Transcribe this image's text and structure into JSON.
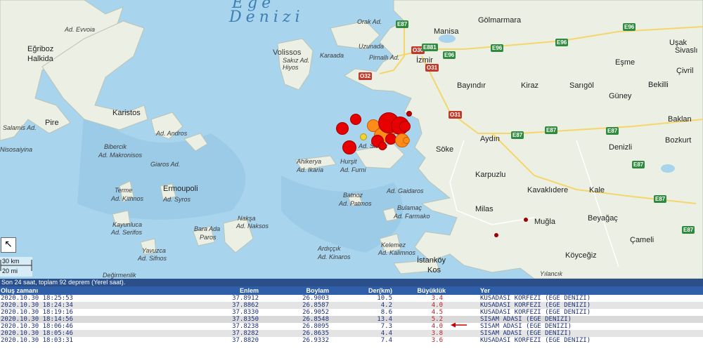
{
  "map": {
    "sea_name_line1": "Ege",
    "sea_name_line2": "Denizi",
    "scale": {
      "km": "30 km",
      "mi": "20 mi"
    },
    "cities": [
      {
        "id": "manisa",
        "name": "Manisa"
      },
      {
        "id": "golmarmara",
        "name": "Gölmarmara"
      },
      {
        "id": "usak",
        "name": "Uşak"
      },
      {
        "id": "izmir",
        "name": "İzmir"
      },
      {
        "id": "bayindir",
        "name": "Bayındır"
      },
      {
        "id": "kiraz",
        "name": "Kiraz"
      },
      {
        "id": "sarigol",
        "name": "Sarıgöl"
      },
      {
        "id": "esme",
        "name": "Eşme"
      },
      {
        "id": "sivasli",
        "name": "Sivaslı"
      },
      {
        "id": "civril",
        "name": "Çivril"
      },
      {
        "id": "guney",
        "name": "Güney"
      },
      {
        "id": "bekilli",
        "name": "Bekilli"
      },
      {
        "id": "baklan",
        "name": "Baklan"
      },
      {
        "id": "denizli",
        "name": "Denizli"
      },
      {
        "id": "bozkurt",
        "name": "Bozkurt"
      },
      {
        "id": "aydin",
        "name": "Aydın"
      },
      {
        "id": "soke",
        "name": "Söke"
      },
      {
        "id": "karpuzlu",
        "name": "Karpuzlu"
      },
      {
        "id": "kavaklidere",
        "name": "Kavaklıdere"
      },
      {
        "id": "kale",
        "name": "Kale"
      },
      {
        "id": "milas",
        "name": "Milas"
      },
      {
        "id": "mugla",
        "name": "Muğla"
      },
      {
        "id": "beyagac",
        "name": "Beyağaç"
      },
      {
        "id": "cameli",
        "name": "Çameli"
      },
      {
        "id": "koycegiz",
        "name": "Köyceğiz"
      },
      {
        "id": "istankoy",
        "name": "İstanköy"
      },
      {
        "id": "kos",
        "name": "Kos"
      },
      {
        "id": "egriboz",
        "name": "Eğriboz"
      },
      {
        "id": "halkida",
        "name": "Halkida"
      },
      {
        "id": "pire",
        "name": "Pire"
      },
      {
        "id": "karistos",
        "name": "Karistos"
      },
      {
        "id": "ermoupoli",
        "name": "Ermoupoli"
      }
    ],
    "islands": [
      {
        "id": "evvoia",
        "name": "Ad. Evvoia"
      },
      {
        "id": "volissos",
        "name": "Volissos"
      },
      {
        "id": "sakiz",
        "name": "Sakız Ad."
      },
      {
        "id": "hiyos",
        "name": "Hiyos"
      },
      {
        "id": "karaada",
        "name": "Karaada"
      },
      {
        "id": "orak",
        "name": "Orak Ad."
      },
      {
        "id": "uzunada",
        "name": "Uzunada"
      },
      {
        "id": "pirnalli",
        "name": "Pirnallı Ad."
      },
      {
        "id": "salamis",
        "name": "Salamis Ad."
      },
      {
        "id": "nisosaiyina",
        "name": "Nisosaiyina"
      },
      {
        "id": "andros",
        "name": "Ad. Andros"
      },
      {
        "id": "bibercik",
        "name": "Bibercik"
      },
      {
        "id": "makronisos",
        "name": "Ad. Makronisos"
      },
      {
        "id": "giaros",
        "name": "Giaros Ad."
      },
      {
        "id": "ahikerya",
        "name": "Ahikerya"
      },
      {
        "id": "ikaria",
        "name": "Ad. Ikaria"
      },
      {
        "id": "sisam",
        "name": "Ad. Sisam"
      },
      {
        "id": "hursit",
        "name": "Hurşit"
      },
      {
        "id": "furni",
        "name": "Ad. Furni"
      },
      {
        "id": "terme",
        "name": "Terme"
      },
      {
        "id": "kithnos",
        "name": "Ad. Kithnos"
      },
      {
        "id": "syros",
        "name": "Ad. Syros"
      },
      {
        "id": "batnoz",
        "name": "Batnoz"
      },
      {
        "id": "patmos",
        "name": "Ad. Patmos"
      },
      {
        "id": "gaidaros",
        "name": "Ad. Gaidaros"
      },
      {
        "id": "bulamac",
        "name": "Bulamaç"
      },
      {
        "id": "farmako",
        "name": "Ad. Farmako"
      },
      {
        "id": "kayunluca",
        "name": "Kayunluca"
      },
      {
        "id": "serifos",
        "name": "Ad. Serifos"
      },
      {
        "id": "naksa",
        "name": "Nakşa"
      },
      {
        "id": "naksos",
        "name": "Ad. Naksos"
      },
      {
        "id": "baraada",
        "name": "Bara Ada"
      },
      {
        "id": "paros",
        "name": "Paros"
      },
      {
        "id": "yavuzca",
        "name": "Yavuzca"
      },
      {
        "id": "sifnos",
        "name": "Ad. Sifnos"
      },
      {
        "id": "ardiccik",
        "name": "Ardıççık"
      },
      {
        "id": "kinaros",
        "name": "Ad. Kinaros"
      },
      {
        "id": "kelemez",
        "name": "Kelemez"
      },
      {
        "id": "kalimnos",
        "name": "Ad. Kalimnos"
      },
      {
        "id": "degirmenlik",
        "name": "Değirmenlik"
      },
      {
        "id": "yilancik",
        "name": "Yılancık"
      }
    ],
    "roads": [
      "E87",
      "E96",
      "E96",
      "E96",
      "E96",
      "E87",
      "E87",
      "E87",
      "E87",
      "E87",
      "E87",
      "O30",
      "O31",
      "O31",
      "O32",
      "E881"
    ],
    "quake_colors": {
      "recent": "#e60000",
      "older": "#ff8c1a",
      "oldest": "#f2d233",
      "outline": "#a00000"
    }
  },
  "table": {
    "summary": "Son 24 saat, toplam 92 deprem (Yerel saat).",
    "headers": {
      "time": "Oluş zamanı",
      "lat": "Enlem",
      "lon": "Boylam",
      "depth": "Der(km)",
      "mag": "Büyüklük",
      "place": "Yer"
    },
    "rows": [
      {
        "time": "2020.10.30 18:25:53",
        "lat": "37.8912",
        "lon": "26.9003",
        "depth": "10.5",
        "mag": "3.4",
        "place": "KUSADASI KORFEZI (EGE DENIZI)"
      },
      {
        "time": "2020.10.30 18:24:34",
        "lat": "37.8862",
        "lon": "26.8587",
        "depth": "4.2",
        "mag": "4.0",
        "place": "KUSADASI KORFEZI (EGE DENIZI)"
      },
      {
        "time": "2020.10.30 18:19:16",
        "lat": "37.8330",
        "lon": "26.9052",
        "depth": "8.6",
        "mag": "4.5",
        "place": "KUSADASI KORFEZI (EGE DENIZI)"
      },
      {
        "time": "2020.10.30 18:14:56",
        "lat": "37.8350",
        "lon": "26.8548",
        "depth": "13.4",
        "mag": "5.2",
        "place": "SISAM ADASI (EGE DENIZI)"
      },
      {
        "time": "2020.10.30 18:06:46",
        "lat": "37.8238",
        "lon": "26.8095",
        "depth": "7.3",
        "mag": "4.0",
        "place": "SISAM ADASI (EGE DENIZI)"
      },
      {
        "time": "2020.10.30 18:05:46",
        "lat": "37.8282",
        "lon": "26.8635",
        "depth": "4.4",
        "mag": "3.8",
        "place": "SISAM ADASI (EGE DENIZI)"
      },
      {
        "time": "2020.10.30 18:03:31",
        "lat": "37.8820",
        "lon": "26.9332",
        "depth": "7.4",
        "mag": "3.6",
        "place": "KUSADASI KORFEZI (EGE DENIZI)"
      }
    ],
    "highlight_arrow_color": "#cc0000"
  }
}
